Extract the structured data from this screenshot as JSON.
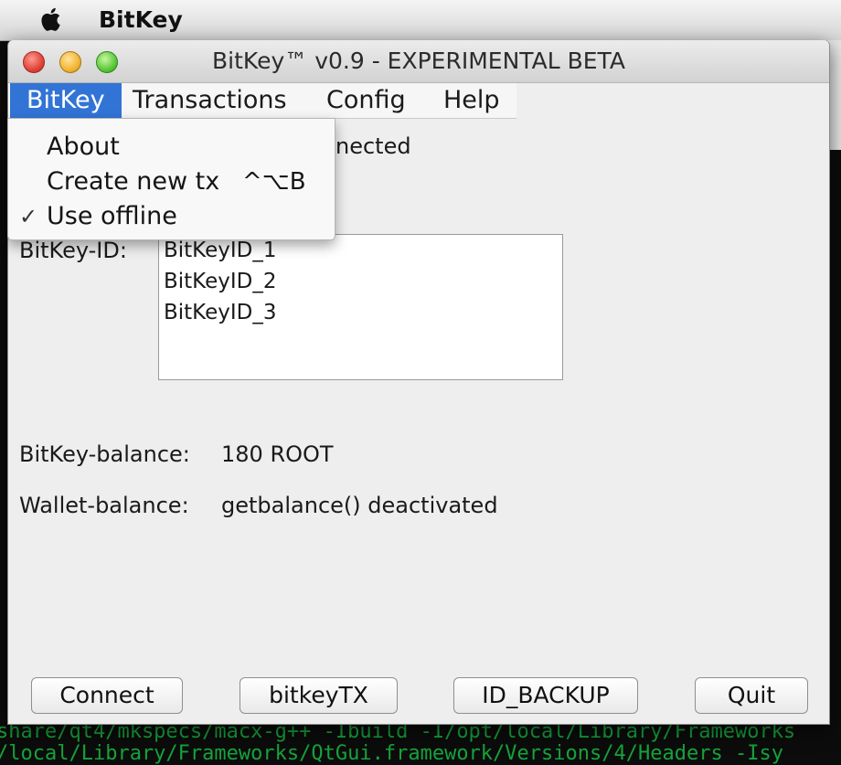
{
  "os_menubar": {
    "app_name": "BitKey"
  },
  "window": {
    "title": "BitKey™ v0.9 - EXPERIMENTAL BETA"
  },
  "menubar": {
    "items": [
      {
        "label": "BitKey"
      },
      {
        "label": "Transactions"
      },
      {
        "label": "Config"
      },
      {
        "label": "Help"
      }
    ]
  },
  "dropdown": {
    "items": [
      {
        "label": "About",
        "shortcut": ""
      },
      {
        "label": "Create new tx",
        "shortcut": "^⌥B"
      },
      {
        "label": "Use offline",
        "shortcut": "",
        "checked": "✓"
      }
    ]
  },
  "status": {
    "partial_text": "nected"
  },
  "bitkey_id": {
    "label": "BitKey-ID:",
    "list": [
      "BitKeyID_1",
      "BitKeyID_2",
      "BitKeyID_3"
    ]
  },
  "balances": {
    "bitkey_label": "BitKey-balance:",
    "bitkey_value": "180 ROOT",
    "wallet_label": "Wallet-balance:",
    "wallet_value": "getbalance() deactivated"
  },
  "buttons": {
    "connect": "Connect",
    "bitkeytx": "bitkeyTX",
    "id_backup": "ID_BACKUP",
    "quit": "Quit"
  },
  "background": {
    "terminal_line_1": "share/qt4/mkspecs/macx-g++ -Ibuild -I/opt/local/Library/Frameworks",
    "terminal_line_2": "/local/Library/Frameworks/QtGui.framework/Versions/4/Headers -Isy"
  },
  "colors": {
    "menu_highlight": "#3274d6",
    "window_bg": "#eeeeee",
    "terminal_green": "#19c53b"
  }
}
